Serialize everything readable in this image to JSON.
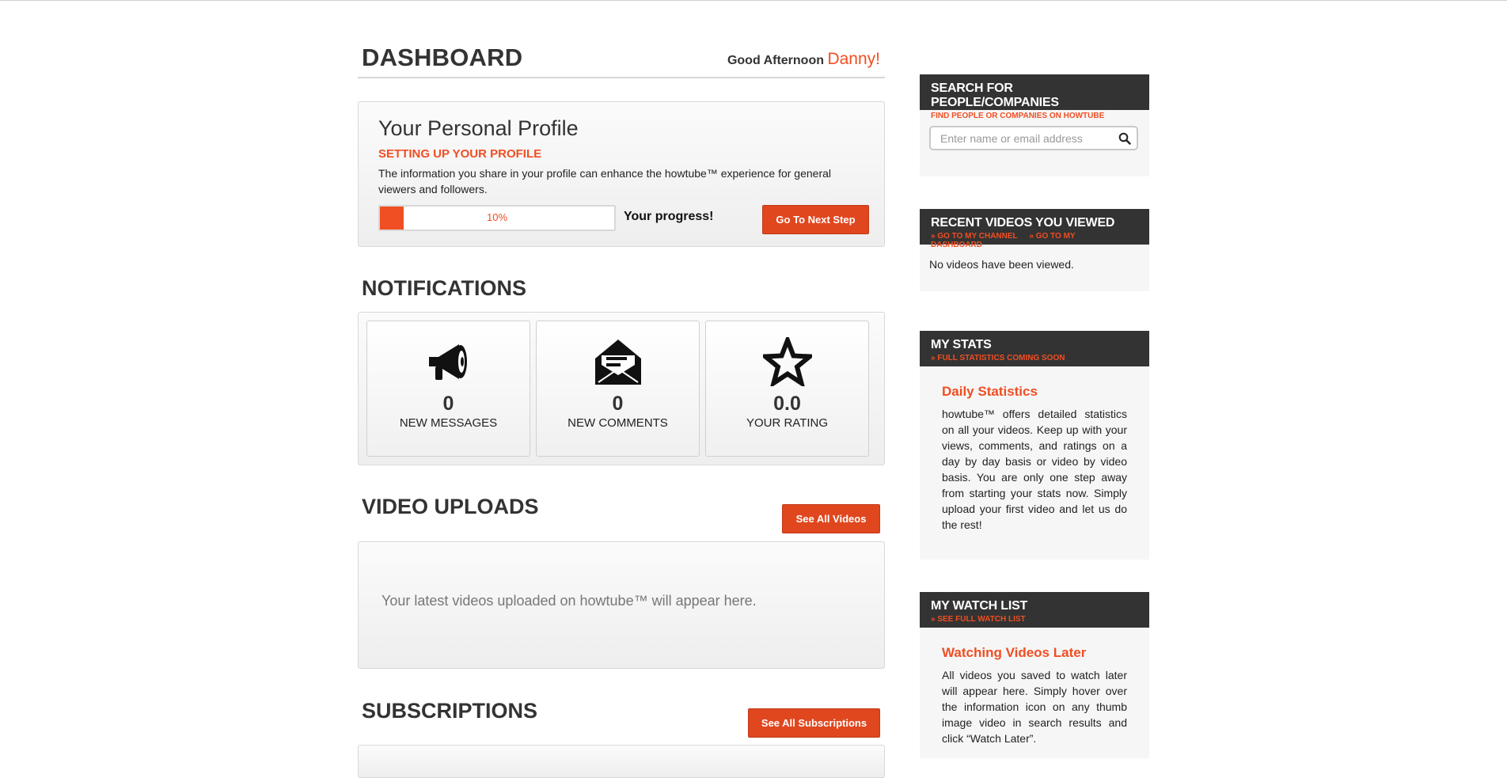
{
  "dashboard": {
    "title": "DASHBOARD",
    "greeting": "Good Afternoon",
    "user_name": "Danny!"
  },
  "profile": {
    "title": "Your Personal Profile",
    "subtitle": "SETTING UP YOUR PROFILE",
    "description": "The information you share in your profile can enhance the howtube™ experience for general viewers and followers.",
    "progress_percent": 10,
    "progress_text": "10%",
    "progress_label": "Your progress!",
    "next_button": "Go To Next Step"
  },
  "notifications": {
    "title": "NOTIFICATIONS",
    "cards": [
      {
        "icon": "megaphone-icon",
        "value": "0",
        "label": "NEW MESSAGES"
      },
      {
        "icon": "envelope-open-icon",
        "value": "0",
        "label": "NEW COMMENTS"
      },
      {
        "icon": "star-icon",
        "value": "0.0",
        "label": "YOUR RATING"
      }
    ]
  },
  "video_uploads": {
    "title": "VIDEO UPLOADS",
    "button": "See All Videos",
    "empty_text": "Your latest videos uploaded on howtube™ will appear here."
  },
  "subscriptions": {
    "title": "SUBSCRIPTIONS",
    "button": "See All Subscriptions"
  },
  "sidebar": {
    "search": {
      "title": "SEARCH FOR PEOPLE/COMPANIES",
      "subtitle": "FIND PEOPLE OR COMPANIES ON HOWTUBE",
      "placeholder": "Enter name or email address"
    },
    "recent": {
      "title": "RECENT VIDEOS YOU VIEWED",
      "link_channel": "» GO TO MY CHANNEL",
      "link_dashboard": "» GO TO MY DASHBOARD",
      "empty_text": "No videos have been viewed."
    },
    "stats": {
      "title": "MY STATS",
      "subtitle": "» FULL STATISTICS COMING SOON",
      "heading": "Daily Statistics",
      "body": "howtube™ offers detailed statistics on all your videos. Keep up with your views, comments, and ratings on a day by day basis or video by video basis. You are only one step away from starting your stats now. Simply upload your first video and let us do the rest!"
    },
    "watchlist": {
      "title": "MY WATCH LIST",
      "subtitle": "» SEE FULL WATCH LIST",
      "heading": "Watching Videos Later",
      "body": "All videos you saved to watch later will appear here. Simply hover over the information icon on any thumb image video in search results and click “Watch Later”."
    }
  },
  "colors": {
    "accent": "#f04e23",
    "button": "#e0471f",
    "sidebar_header": "#333333"
  }
}
